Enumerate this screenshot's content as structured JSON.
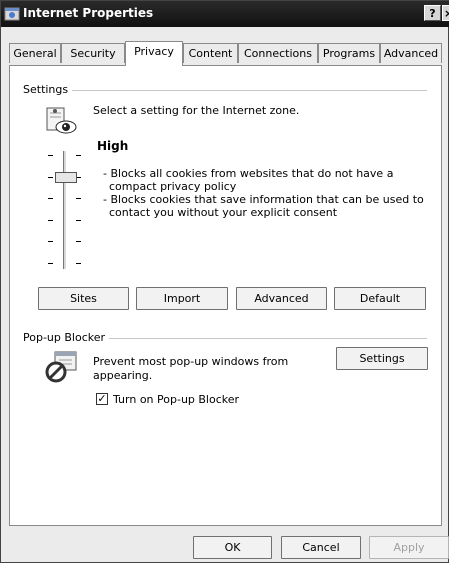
{
  "window": {
    "title": "Internet Properties",
    "help_label": "?",
    "close_label": "×"
  },
  "tabs": [
    {
      "label": "General"
    },
    {
      "label": "Security"
    },
    {
      "label": "Privacy",
      "active": true
    },
    {
      "label": "Content"
    },
    {
      "label": "Connections"
    },
    {
      "label": "Programs"
    },
    {
      "label": "Advanced"
    }
  ],
  "settings": {
    "group_label": "Settings",
    "intro_text": "Select a setting for the Internet zone.",
    "level_title": "High",
    "bullets": [
      "- Blocks all cookies from websites that do not have a",
      "compact privacy policy",
      "- Blocks cookies that save information that can be used to",
      "contact you without your explicit consent"
    ],
    "slider_level": 5,
    "slider_levels_total": 6,
    "buttons": {
      "sites": "Sites",
      "import": "Import",
      "advanced": "Advanced",
      "default": "Default"
    }
  },
  "popup_blocker": {
    "group_label": "Pop-up Blocker",
    "description_line1": "Prevent most pop-up windows from",
    "description_line2": "appearing.",
    "settings_button": "Settings",
    "checkbox_label": "Turn on Pop-up Blocker",
    "checkbox_checked": true,
    "checkmark": "✓"
  },
  "footer": {
    "ok": "OK",
    "cancel": "Cancel",
    "apply": "Apply"
  }
}
